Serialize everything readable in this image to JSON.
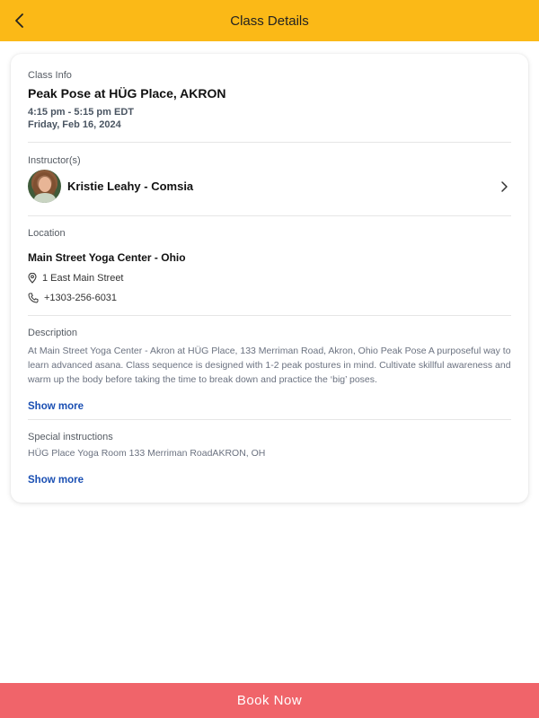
{
  "header": {
    "title": "Class Details",
    "back_icon": "chevron-left-icon"
  },
  "class_info": {
    "label": "Class Info",
    "title": "Peak Pose at HÜG Place, AKRON",
    "time": "4:15 pm - 5:15 pm EDT",
    "date": "Friday, Feb 16, 2024"
  },
  "instructor": {
    "label": "Instructor(s)",
    "name": "Kristie Leahy - Comsia"
  },
  "location": {
    "label": "Location",
    "name": "Main Street Yoga Center - Ohio",
    "address": "1 East Main Street",
    "phone": "+1303-256-6031"
  },
  "description": {
    "label": "Description",
    "text": "At Main Street Yoga Center - Akron at HÜG Place, 133 Merriman Road, Akron, Ohio Peak Pose A purposeful way to learn advanced asana. Class sequence is designed with 1-2 peak postures in mind. Cultivate skillful awareness and warm up the body before taking the time to break down and practice the ‘big’ poses.",
    "show_more": "Show more"
  },
  "special_instructions": {
    "label": "Special instructions",
    "text": "HÜG Place Yoga Room 133 Merriman RoadAKRON, OH",
    "show_more": "Show more"
  },
  "book": {
    "label": "Book Now"
  },
  "colors": {
    "header_bg": "#fbb917",
    "book_bg": "#f0646a",
    "link": "#1a4fb3"
  }
}
